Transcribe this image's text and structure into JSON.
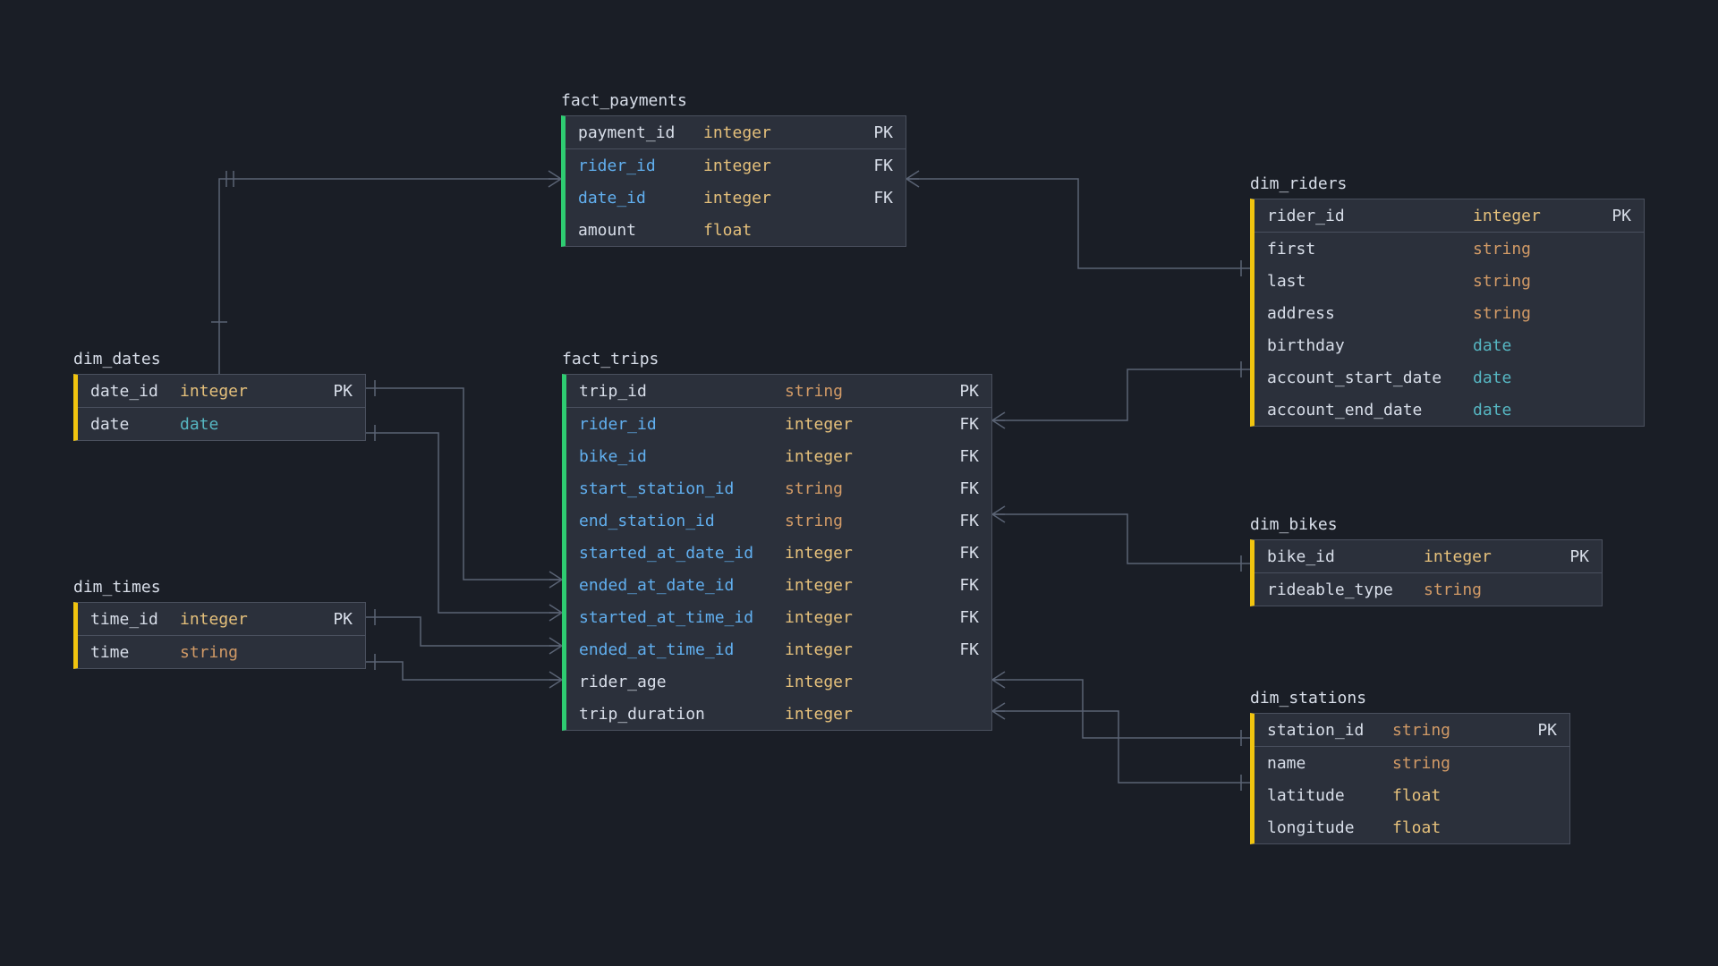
{
  "tables": {
    "fact_payments": {
      "title": "fact_payments",
      "rows": [
        {
          "name": "payment_id",
          "nameClass": "c-white",
          "type": "integer",
          "typeClass": "c-yellow",
          "key": "PK",
          "keyClass": "c-white"
        },
        "sep",
        {
          "name": "rider_id",
          "nameClass": "c-blue",
          "type": "integer",
          "typeClass": "c-yellow",
          "key": "FK",
          "keyClass": "c-blue"
        },
        {
          "name": "date_id",
          "nameClass": "c-blue",
          "type": "integer",
          "typeClass": "c-yellow",
          "key": "FK",
          "keyClass": "c-blue"
        },
        {
          "name": "amount",
          "nameClass": "c-white",
          "type": "float",
          "typeClass": "c-yellow",
          "key": "",
          "keyClass": ""
        }
      ]
    },
    "fact_trips": {
      "title": "fact_trips",
      "rows": [
        {
          "name": "trip_id",
          "nameClass": "c-white",
          "type": "string",
          "typeClass": "c-orange",
          "key": "PK",
          "keyClass": "c-white"
        },
        "sep",
        {
          "name": "rider_id",
          "nameClass": "c-blue",
          "type": "integer",
          "typeClass": "c-yellow",
          "key": "FK",
          "keyClass": "c-blue"
        },
        {
          "name": "bike_id",
          "nameClass": "c-blue",
          "type": "integer",
          "typeClass": "c-yellow",
          "key": "FK",
          "keyClass": "c-blue"
        },
        {
          "name": "start_station_id",
          "nameClass": "c-blue",
          "type": "string",
          "typeClass": "c-orange",
          "key": "FK",
          "keyClass": "c-blue"
        },
        {
          "name": "end_station_id",
          "nameClass": "c-blue",
          "type": "string",
          "typeClass": "c-orange",
          "key": "FK",
          "keyClass": "c-blue"
        },
        {
          "name": "started_at_date_id",
          "nameClass": "c-blue",
          "type": "integer",
          "typeClass": "c-yellow",
          "key": "FK",
          "keyClass": "c-blue"
        },
        {
          "name": "ended_at_date_id",
          "nameClass": "c-blue",
          "type": "integer",
          "typeClass": "c-yellow",
          "key": "FK",
          "keyClass": "c-blue"
        },
        {
          "name": "started_at_time_id",
          "nameClass": "c-blue",
          "type": "integer",
          "typeClass": "c-yellow",
          "key": "FK",
          "keyClass": "c-blue"
        },
        {
          "name": "ended_at_time_id",
          "nameClass": "c-blue",
          "type": "integer",
          "typeClass": "c-yellow",
          "key": "FK",
          "keyClass": "c-blue"
        },
        {
          "name": "rider_age",
          "nameClass": "c-white",
          "type": "integer",
          "typeClass": "c-yellow",
          "key": "",
          "keyClass": ""
        },
        {
          "name": "trip_duration",
          "nameClass": "c-white",
          "type": "integer",
          "typeClass": "c-yellow",
          "key": "",
          "keyClass": ""
        }
      ]
    },
    "dim_dates": {
      "title": "dim_dates",
      "rows": [
        {
          "name": "date_id",
          "nameClass": "c-white",
          "type": "integer",
          "typeClass": "c-yellow",
          "key": "PK",
          "keyClass": "c-white"
        },
        "sep",
        {
          "name": "date",
          "nameClass": "c-white",
          "type": "date",
          "typeClass": "c-teal",
          "key": "",
          "keyClass": ""
        }
      ]
    },
    "dim_times": {
      "title": "dim_times",
      "rows": [
        {
          "name": "time_id",
          "nameClass": "c-white",
          "type": "integer",
          "typeClass": "c-yellow",
          "key": "PK",
          "keyClass": "c-white"
        },
        "sep",
        {
          "name": "time",
          "nameClass": "c-white",
          "type": "string",
          "typeClass": "c-orange",
          "key": "",
          "keyClass": ""
        }
      ]
    },
    "dim_riders": {
      "title": "dim_riders",
      "rows": [
        {
          "name": "rider_id",
          "nameClass": "c-white",
          "type": "integer",
          "typeClass": "c-yellow",
          "key": "PK",
          "keyClass": "c-white"
        },
        "sep",
        {
          "name": "first",
          "nameClass": "c-white",
          "type": "string",
          "typeClass": "c-orange",
          "key": "",
          "keyClass": ""
        },
        {
          "name": "last",
          "nameClass": "c-white",
          "type": "string",
          "typeClass": "c-orange",
          "key": "",
          "keyClass": ""
        },
        {
          "name": "address",
          "nameClass": "c-white",
          "type": "string",
          "typeClass": "c-orange",
          "key": "",
          "keyClass": ""
        },
        {
          "name": "birthday",
          "nameClass": "c-white",
          "type": "date",
          "typeClass": "c-teal",
          "key": "",
          "keyClass": ""
        },
        {
          "name": "account_start_date",
          "nameClass": "c-white",
          "type": "date",
          "typeClass": "c-teal",
          "key": "",
          "keyClass": ""
        },
        {
          "name": "account_end_date",
          "nameClass": "c-white",
          "type": "date",
          "typeClass": "c-teal",
          "key": "",
          "keyClass": ""
        }
      ]
    },
    "dim_bikes": {
      "title": "dim_bikes",
      "rows": [
        {
          "name": "bike_id",
          "nameClass": "c-white",
          "type": "integer",
          "typeClass": "c-yellow",
          "key": "PK",
          "keyClass": "c-white"
        },
        "sep",
        {
          "name": "rideable_type",
          "nameClass": "c-white",
          "type": "string",
          "typeClass": "c-orange",
          "key": "",
          "keyClass": ""
        }
      ]
    },
    "dim_stations": {
      "title": "dim_stations",
      "rows": [
        {
          "name": "station_id",
          "nameClass": "c-white",
          "type": "string",
          "typeClass": "c-orange",
          "key": "PK",
          "keyClass": "c-white"
        },
        "sep",
        {
          "name": "name",
          "nameClass": "c-white",
          "type": "string",
          "typeClass": "c-orange",
          "key": "",
          "keyClass": ""
        },
        {
          "name": "latitude",
          "nameClass": "c-white",
          "type": "float",
          "typeClass": "c-yellow",
          "key": "",
          "keyClass": ""
        },
        {
          "name": "longitude",
          "nameClass": "c-white",
          "type": "float",
          "typeClass": "c-yellow",
          "key": "",
          "keyClass": ""
        }
      ]
    }
  }
}
